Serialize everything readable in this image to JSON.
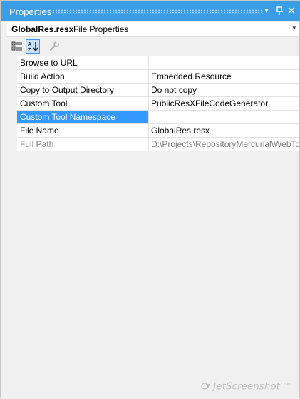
{
  "window": {
    "title": "Properties"
  },
  "title_buttons": {
    "dropdown_glyph": "▾",
    "pin_glyph": "⊥",
    "close_glyph": "✕"
  },
  "selector": {
    "object_name": "GlobalRes.resx",
    "object_type": "File Properties",
    "dropdown_glyph": "▾"
  },
  "toolbar": {
    "items": [
      "categorized",
      "alphabetical",
      "property-pages"
    ],
    "active": "alphabetical"
  },
  "properties": [
    {
      "name": "Browse to URL",
      "value": "",
      "state": "normal"
    },
    {
      "name": "Build Action",
      "value": "Embedded Resource",
      "state": "normal"
    },
    {
      "name": "Copy to Output Directory",
      "value": "Do not copy",
      "state": "normal"
    },
    {
      "name": "Custom Tool",
      "value": "PublicResXFileCodeGenerator",
      "state": "normal"
    },
    {
      "name": "Custom Tool Namespace",
      "value": "",
      "state": "selected"
    },
    {
      "name": "File Name",
      "value": "GlobalRes.resx",
      "state": "normal"
    },
    {
      "name": "Full Path",
      "value": "D:\\Projects\\RepositoryMercurial\\WebTools",
      "state": "readonly"
    }
  ],
  "watermark": {
    "text": "JetScreenshot",
    "superscript": "com"
  },
  "colors": {
    "title_bar": "#3b9de6",
    "selection": "#3399ff",
    "readonly_text": "#808080"
  }
}
